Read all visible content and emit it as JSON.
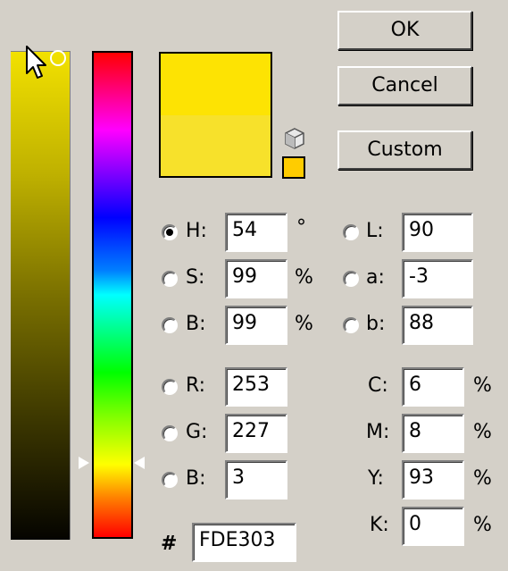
{
  "buttons": {
    "ok": "OK",
    "cancel": "Cancel",
    "custom": "Custom"
  },
  "colors": {
    "new_color": "#FDE303",
    "old_color": "#F7E12B",
    "websafe_color": "#FFCC00",
    "dialog_bg": "#d4d0c8"
  },
  "hsb": {
    "h": {
      "label": "H:",
      "value": "54",
      "unit": "°",
      "selected": true
    },
    "s": {
      "label": "S:",
      "value": "99",
      "unit": "%"
    },
    "b": {
      "label": "B:",
      "value": "99",
      "unit": "%"
    }
  },
  "lab": {
    "l": {
      "label": "L:",
      "value": "90"
    },
    "a": {
      "label": "a:",
      "value": "-3"
    },
    "b": {
      "label": "b:",
      "value": "88"
    }
  },
  "rgb": {
    "r": {
      "label": "R:",
      "value": "253"
    },
    "g": {
      "label": "G:",
      "value": "227"
    },
    "b": {
      "label": "B:",
      "value": "3"
    }
  },
  "cmyk": {
    "c": {
      "label": "C:",
      "value": "6",
      "unit": "%"
    },
    "m": {
      "label": "M:",
      "value": "8",
      "unit": "%"
    },
    "y": {
      "label": "Y:",
      "value": "93",
      "unit": "%"
    },
    "k": {
      "label": "K:",
      "value": "0",
      "unit": "%"
    }
  },
  "hex": {
    "label": "#",
    "value": "FDE303"
  },
  "icons": {
    "cursor": "arrow-cursor-icon",
    "gamut": "cube-icon"
  }
}
